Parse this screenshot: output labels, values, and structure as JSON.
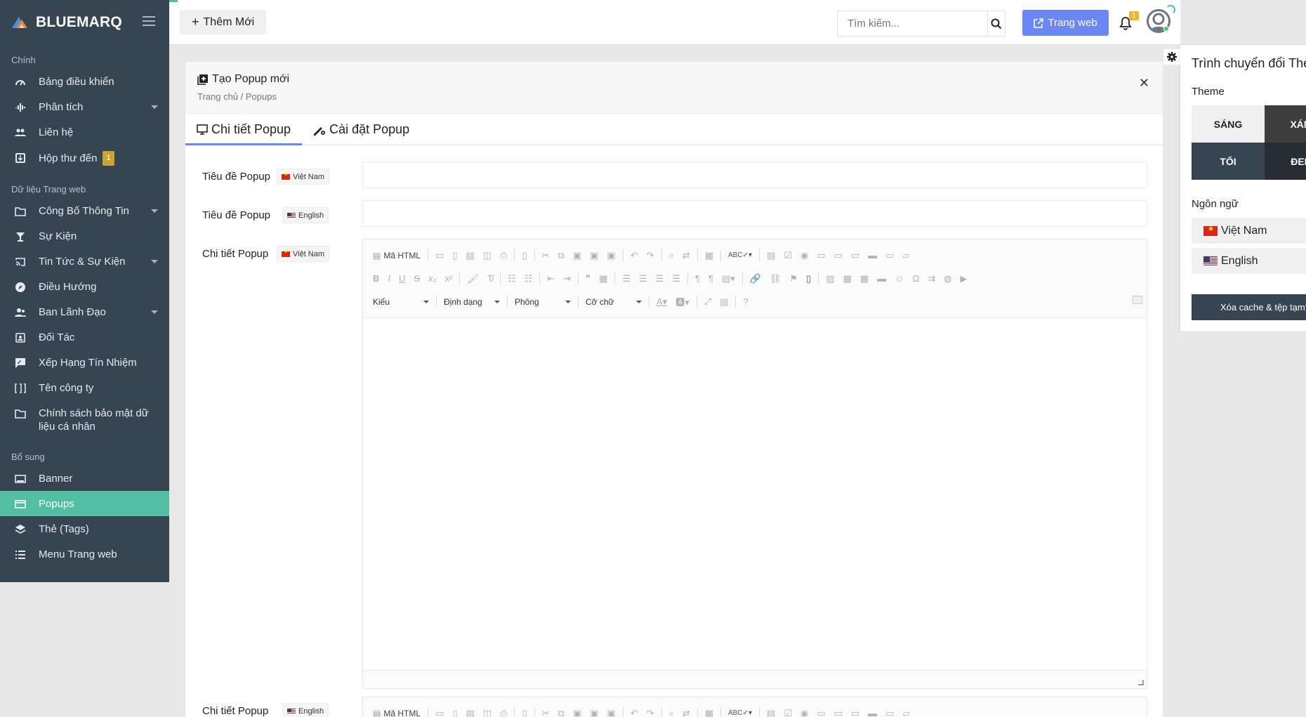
{
  "brand": {
    "name": "BLUEMARQ",
    "colors": {
      "sidebar": "#374451",
      "accent": "#52bea4",
      "primary": "#6b87f3"
    }
  },
  "sidebar": {
    "sections": [
      {
        "label": "Chính"
      },
      {
        "label": "Dữ liệu Trang web"
      },
      {
        "label": "Bổ sung"
      }
    ],
    "items": [
      {
        "label": "Bảng điều khiển",
        "icon": "dashboard-icon"
      },
      {
        "label": "Phân tích",
        "icon": "analytics-icon"
      },
      {
        "label": "Liên hệ",
        "icon": "contacts-icon"
      },
      {
        "label": "Hộp thư đến",
        "icon": "inbox-icon",
        "badge": "1"
      },
      {
        "label": "Công Bố Thông Tin",
        "icon": "folder-icon"
      },
      {
        "label": "Sự Kiện",
        "icon": "event-icon"
      },
      {
        "label": "Tin Tức & Sự Kiện",
        "icon": "cast-icon"
      },
      {
        "label": "Điều Hướng",
        "icon": "compass-icon"
      },
      {
        "label": "Ban Lãnh Đạo",
        "icon": "people-icon"
      },
      {
        "label": "Đối Tác",
        "icon": "partner-icon"
      },
      {
        "label": "Xếp Hạng Tín Nhiệm",
        "icon": "rating-icon"
      },
      {
        "label": "Tên công ty",
        "icon": "company-icon"
      },
      {
        "label": "Chính sách bảo mật dữ liệu cá nhân",
        "icon": "folder-icon"
      },
      {
        "label": "Banner",
        "icon": "banner-icon"
      },
      {
        "label": "Popups",
        "icon": "popup-icon"
      },
      {
        "label": "Thẻ (Tags)",
        "icon": "layers-icon"
      },
      {
        "label": "Menu Trang web",
        "icon": "list-icon"
      }
    ]
  },
  "topbar": {
    "add_label": "Thêm Mới",
    "search_placeholder": "Tìm kiếm...",
    "website_label": "Trang web",
    "notification_count": "1"
  },
  "main": {
    "title": "Tạo Popup mới",
    "breadcrumb": "Trang chủ / Popups",
    "tabs": [
      {
        "label": "Chi tiết Popup"
      },
      {
        "label": "Cài đặt Popup"
      }
    ],
    "fields": [
      {
        "label": "Tiêu đề Popup",
        "lang": "Việt Nam"
      },
      {
        "label": "Tiêu đề Popup",
        "lang": "English"
      },
      {
        "label": "Chi tiết Popup",
        "lang": "Việt Nam"
      },
      {
        "label": "Chi tiết Popup",
        "lang": "English"
      }
    ],
    "editor": {
      "source_label": "Mã HTML",
      "combos": [
        "Kiểu",
        "Định dạng",
        "Phông",
        "Cỡ chữ"
      ]
    }
  },
  "theme_panel": {
    "title": "Trình chuyển đổi Theme",
    "theme_label": "Theme",
    "themes": [
      "SÁNG",
      "XÁM",
      "TỐI",
      "ĐEN"
    ],
    "language_label": "Ngôn ngữ",
    "languages": [
      "Việt Nam",
      "English"
    ],
    "clear_cache_label": "Xóa cache & tệp tạm?"
  }
}
